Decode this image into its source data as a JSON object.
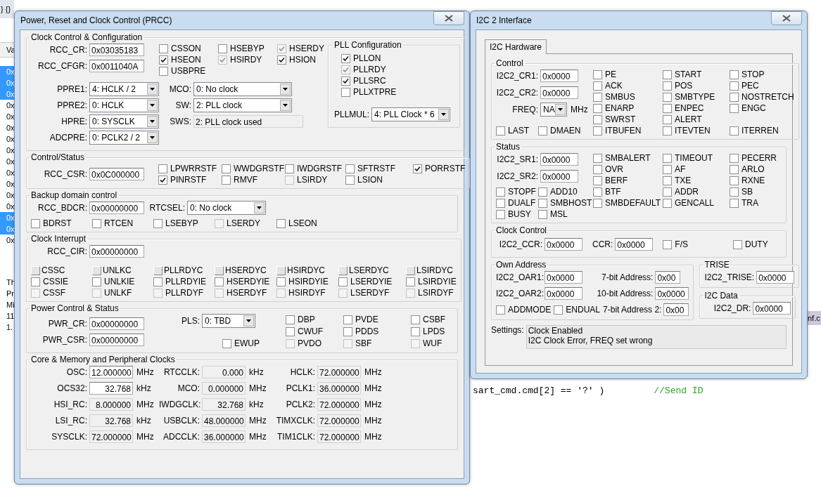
{
  "background": {
    "toolbar_text": "} {}",
    "watch_header": "Va",
    "watch_rows": [
      {
        "text": "0x",
        "selected": true
      },
      {
        "text": "0x",
        "selected": true
      },
      {
        "text": "0x",
        "selected": true
      },
      {
        "text": "0x",
        "selected": false
      },
      {
        "text": "0x",
        "selected": false
      },
      {
        "text": "0x",
        "selected": false
      },
      {
        "text": "0x",
        "selected": false
      },
      {
        "text": "0x",
        "selected": false
      },
      {
        "text": "0x",
        "selected": false
      },
      {
        "text": "0x",
        "selected": false
      },
      {
        "text": "0x",
        "selected": false
      },
      {
        "text": "0x",
        "selected": false
      },
      {
        "text": "0x",
        "selected": false
      },
      {
        "text": "0x",
        "selected": true
      },
      {
        "text": "0x",
        "selected": true
      },
      {
        "text": "0x",
        "selected": false
      }
    ],
    "notes": [
      "Th",
      "Pr",
      "Mi",
      "11",
      "1."
    ],
    "file_tab": "nf.c",
    "code": "sart_cmd.cmd[2] == '?' )",
    "comment": "//Send ID"
  },
  "prcc": {
    "title": "Power, Reset and Clock Control (PRCC)",
    "clock_config": {
      "title": "Clock Control & Configuration",
      "registers": [
        {
          "label": "RCC_CR:",
          "value": "0x03035183"
        },
        {
          "label": "RCC_CFGR:",
          "value": "0x0011040A"
        }
      ],
      "checks": [
        {
          "label": "CSSON",
          "checked": false,
          "disabled": false
        },
        {
          "label": "HSEBYP",
          "checked": false,
          "disabled": false
        },
        {
          "label": "HSERDY",
          "checked": true,
          "disabled": true
        },
        {
          "label": "HSEON",
          "checked": true,
          "disabled": false
        },
        {
          "label": "HSIRDY",
          "checked": true,
          "disabled": true
        },
        {
          "label": "HSION",
          "checked": true,
          "disabled": false
        },
        {
          "label": "USBPRE",
          "checked": false,
          "disabled": false
        }
      ],
      "selects": [
        {
          "label": "PPRE1:",
          "value": "4: HCLK / 2"
        },
        {
          "label": "PPRE2:",
          "value": "0: HCLK"
        },
        {
          "label": "HPRE:",
          "value": "0: SYSCLK"
        },
        {
          "label": "ADCPRE:",
          "value": "0: PCLK2 / 2"
        }
      ],
      "mid_selects": [
        {
          "label": "MCO:",
          "value": "0: No clock"
        },
        {
          "label": "SW:",
          "value": "2: PLL clock"
        }
      ],
      "sws": {
        "label": "SWS:",
        "value": "2: PLL clock used"
      },
      "pll": {
        "title": "PLL Configuration",
        "checks": [
          {
            "label": "PLLON",
            "checked": true,
            "disabled": false
          },
          {
            "label": "PLLRDY",
            "checked": true,
            "disabled": true
          },
          {
            "label": "PLLSRC",
            "checked": true,
            "disabled": false
          },
          {
            "label": "PLLXTPRE",
            "checked": false,
            "disabled": false
          }
        ],
        "mul": {
          "label": "PLLMUL:",
          "value": "4: PLL Clock * 6"
        }
      }
    },
    "control_status": {
      "title": "Control/Status",
      "register": {
        "label": "RCC_CSR:",
        "value": "0x0C000000"
      },
      "checks": [
        {
          "label": "LPWRRSTF",
          "checked": false,
          "disabled": false
        },
        {
          "label": "WWDGRSTF",
          "checked": false,
          "disabled": false
        },
        {
          "label": "IWDGRSTF",
          "checked": false,
          "disabled": false
        },
        {
          "label": "SFTRSTF",
          "checked": false,
          "disabled": false
        },
        {
          "label": "PORRSTF",
          "checked": true,
          "disabled": false
        },
        {
          "label": "PINRSTF",
          "checked": true,
          "disabled": false
        },
        {
          "label": "RMVF",
          "checked": false,
          "disabled": false
        },
        {
          "label": "LSIRDY",
          "checked": false,
          "disabled": true
        },
        {
          "label": "LSION",
          "checked": false,
          "disabled": false
        }
      ]
    },
    "backup": {
      "title": "Backup domain control",
      "register": {
        "label": "RCC_BDCR:",
        "value": "0x00000000"
      },
      "select": {
        "label": "RTCSEL:",
        "value": "0: No clock"
      },
      "checks": [
        {
          "label": "BDRST",
          "checked": false,
          "disabled": false
        },
        {
          "label": "RTCEN",
          "checked": false,
          "disabled": false
        },
        {
          "label": "LSEBYP",
          "checked": false,
          "disabled": false
        },
        {
          "label": "LSERDY",
          "checked": false,
          "disabled": true
        },
        {
          "label": "LSEON",
          "checked": false,
          "disabled": false
        }
      ]
    },
    "interrupt": {
      "title": "Clock Interrupt",
      "register": {
        "label": "RCC_CIR:",
        "value": "0x00000000"
      },
      "checks": [
        {
          "kind": "pulse",
          "label": "CSSC",
          "checked": false,
          "disabled": false
        },
        {
          "kind": "pulse",
          "label": "UNLKC",
          "checked": false,
          "disabled": false
        },
        {
          "kind": "pulse",
          "label": "PLLRDYC",
          "checked": false,
          "disabled": false
        },
        {
          "kind": "pulse",
          "label": "HSERDYC",
          "checked": false,
          "disabled": false
        },
        {
          "kind": "pulse",
          "label": "HSIRDYC",
          "checked": false,
          "disabled": false
        },
        {
          "kind": "pulse",
          "label": "LSERDYC",
          "checked": false,
          "disabled": false
        },
        {
          "kind": "pulse",
          "label": "LSIRDYC",
          "checked": false,
          "disabled": false
        },
        {
          "kind": "check",
          "label": "CSSIE",
          "checked": false,
          "disabled": false
        },
        {
          "kind": "check",
          "label": "UNLKIE",
          "checked": false,
          "disabled": false
        },
        {
          "kind": "check",
          "label": "PLLRDYIE",
          "checked": false,
          "disabled": false
        },
        {
          "kind": "check",
          "label": "HSERDYIE",
          "checked": false,
          "disabled": false
        },
        {
          "kind": "check",
          "label": "HSIRDYIE",
          "checked": false,
          "disabled": false
        },
        {
          "kind": "check",
          "label": "LSERDYIE",
          "checked": false,
          "disabled": false
        },
        {
          "kind": "check",
          "label": "LSIRDYIE",
          "checked": false,
          "disabled": false
        },
        {
          "kind": "check",
          "label": "CSSF",
          "checked": false,
          "disabled": true
        },
        {
          "kind": "check",
          "label": "UNLKF",
          "checked": false,
          "disabled": true
        },
        {
          "kind": "check",
          "label": "PLLRDYF",
          "checked": false,
          "disabled": true
        },
        {
          "kind": "check",
          "label": "HSERDYF",
          "checked": false,
          "disabled": true
        },
        {
          "kind": "check",
          "label": "HSIRDYF",
          "checked": false,
          "disabled": true
        },
        {
          "kind": "check",
          "label": "LSERDYF",
          "checked": false,
          "disabled": true
        },
        {
          "kind": "check",
          "label": "LSIRDYF",
          "checked": false,
          "disabled": true
        }
      ]
    },
    "power": {
      "title": "Power Control & Status",
      "registers": [
        {
          "label": "PWR_CR:",
          "value": "0x00000000"
        },
        {
          "label": "PWR_CSR:",
          "value": "0x00000000"
        }
      ],
      "select": {
        "label": "PLS:",
        "value": "0: TBD"
      },
      "checks": [
        {
          "label": "DBP",
          "checked": false,
          "disabled": false
        },
        {
          "label": "PVDE",
          "checked": false,
          "disabled": false
        },
        {
          "label": "CSBF",
          "checked": false,
          "disabled": false
        },
        {
          "label": "CWUF",
          "checked": false,
          "disabled": false
        },
        {
          "label": "PDDS",
          "checked": false,
          "disabled": false
        },
        {
          "label": "LPDS",
          "checked": false,
          "disabled": false
        },
        {
          "label": "EWUP",
          "checked": false,
          "disabled": false
        },
        {
          "label": "PVDO",
          "checked": false,
          "disabled": true
        },
        {
          "label": "SBF",
          "checked": false,
          "disabled": true
        },
        {
          "label": "WUF",
          "checked": false,
          "disabled": true
        }
      ]
    },
    "clocks": {
      "title": "Core & Memory and Peripheral Clocks",
      "columns": [
        [
          {
            "label": "OSC:",
            "value": "12.000000",
            "unit": "MHz",
            "editable": true
          },
          {
            "label": "OCS32:",
            "value": "32.768",
            "unit": "kHz",
            "editable": true
          },
          {
            "label": "HSI_RC:",
            "value": "8.000000",
            "unit": "MHz",
            "editable": false
          },
          {
            "label": "LSI_RC:",
            "value": "32.768",
            "unit": "kHz",
            "editable": false
          },
          {
            "label": "SYSCLK:",
            "value": "72.000000",
            "unit": "MHz",
            "editable": false
          }
        ],
        [
          {
            "label": "RTCCLK:",
            "value": "0.000",
            "unit": "kHz",
            "editable": false
          },
          {
            "label": "MCO:",
            "value": "0.000000",
            "unit": "MHz",
            "editable": false
          },
          {
            "label": "IWDGCLK:",
            "value": "32.768",
            "unit": "kHz",
            "editable": false
          },
          {
            "label": "USBCLK:",
            "value": "48.000000",
            "unit": "MHz",
            "editable": false
          },
          {
            "label": "ADCCLK:",
            "value": "36.000000",
            "unit": "MHz",
            "editable": false
          }
        ],
        [
          {
            "label": "HCLK:",
            "value": "72.000000",
            "unit": "MHz",
            "editable": false
          },
          {
            "label": "PCLK1:",
            "value": "36.000000",
            "unit": "MHz",
            "editable": false
          },
          {
            "label": "PCLK2:",
            "value": "72.000000",
            "unit": "MHz",
            "editable": false
          },
          {
            "label": "TIMXCLK:",
            "value": "72.000000",
            "unit": "MHz",
            "editable": false
          },
          {
            "label": "TIM1CLK:",
            "value": "72.000000",
            "unit": "MHz",
            "editable": false
          }
        ]
      ]
    }
  },
  "i2c": {
    "title": "I2C 2 Interface",
    "tabs": [
      {
        "label": "I2C Hardware",
        "selected": true
      }
    ],
    "control": {
      "title": "Control",
      "registers": [
        {
          "label": "I2C2_CR1:",
          "value": "0x0000"
        },
        {
          "label": "I2C2_CR2:",
          "value": "0x0000"
        }
      ],
      "freq": {
        "label": "FREQ:",
        "value": "NA",
        "unit": "MHz"
      },
      "checks": [
        {
          "label": "PE",
          "checked": false
        },
        {
          "label": "START",
          "checked": false
        },
        {
          "label": "STOP",
          "checked": false
        },
        {
          "label": "ACK",
          "checked": false
        },
        {
          "label": "POS",
          "checked": false
        },
        {
          "label": "PEC",
          "checked": false
        },
        {
          "label": "SMBUS",
          "checked": false
        },
        {
          "label": "SMBTYPE",
          "checked": false
        },
        {
          "label": "NOSTRETCH",
          "checked": false
        },
        {
          "label": "ENARP",
          "checked": false
        },
        {
          "label": "ENPEC",
          "checked": false
        },
        {
          "label": "ENGC",
          "checked": false
        },
        {
          "label": "SWRST",
          "checked": false
        },
        {
          "label": "ALERT",
          "checked": false
        }
      ],
      "bottom_checks": [
        {
          "label": "LAST",
          "checked": false
        },
        {
          "label": "DMAEN",
          "checked": false
        },
        {
          "label": "ITBUFEN",
          "checked": false
        },
        {
          "label": "ITEVTEN",
          "checked": false
        },
        {
          "label": "ITERREN",
          "checked": false
        }
      ]
    },
    "status": {
      "title": "Status",
      "registers": [
        {
          "label": "I2C2_SR1:",
          "value": "0x0000"
        },
        {
          "label": "I2C2_SR2:",
          "value": "0x0000"
        }
      ],
      "checks": [
        {
          "label": "SMBALERT",
          "checked": false
        },
        {
          "label": "TIMEOUT",
          "checked": false
        },
        {
          "label": "PECERR",
          "checked": false
        },
        {
          "label": "OVR",
          "checked": false
        },
        {
          "label": "AF",
          "checked": false
        },
        {
          "label": "ARLO",
          "checked": false
        },
        {
          "label": "BERF",
          "checked": false
        },
        {
          "label": "TXE",
          "checked": false
        },
        {
          "label": "RXNE",
          "checked": false
        }
      ],
      "bottom_checks": [
        {
          "label": "STOPF",
          "checked": false
        },
        {
          "label": "ADD10",
          "checked": false
        },
        {
          "label": "BTF",
          "checked": false
        },
        {
          "label": "ADDR",
          "checked": false
        },
        {
          "label": "SB",
          "checked": false
        },
        {
          "label": "DUALF",
          "checked": false
        },
        {
          "label": "SMBHOST",
          "checked": false
        },
        {
          "label": "SMBDEFAULT",
          "checked": false
        },
        {
          "label": "GENCALL",
          "checked": false
        },
        {
          "label": "TRA",
          "checked": false
        },
        {
          "label": "BUSY",
          "checked": false
        },
        {
          "label": "MSL",
          "checked": false
        }
      ]
    },
    "clock_control": {
      "title": "Clock Control",
      "fields": [
        {
          "label": "I2C2_CCR:",
          "value": "0x0000"
        },
        {
          "label": "CCR:",
          "value": "0x0000"
        }
      ],
      "checks": [
        {
          "label": "F/S",
          "checked": false
        },
        {
          "label": "DUTY",
          "checked": false
        }
      ]
    },
    "own_address": {
      "title": "Own Address",
      "registers": [
        {
          "label": "I2C2_OAR1:",
          "value": "0x0000"
        },
        {
          "label": "I2C2_OAR2:",
          "value": "0x0000"
        }
      ],
      "addresses": [
        {
          "label": "7-bit Address:",
          "value": "0x00"
        },
        {
          "label": "10-bit Address:",
          "value": "0x0000"
        }
      ],
      "checks": [
        {
          "label": "ADDMODE",
          "checked": false
        },
        {
          "label": "ENDUAL",
          "checked": false
        }
      ],
      "address2": {
        "label": "7-bit Address 2:",
        "value": "0x00"
      }
    },
    "trise": {
      "title": "TRISE",
      "register": {
        "label": "I2C2_TRISE:",
        "value": "0x0000"
      }
    },
    "data": {
      "title": "I2C Data",
      "register": {
        "label": "I2C2_DR:",
        "value": "0x0000"
      }
    },
    "settings": {
      "label": "Settings:",
      "lines": [
        "Clock Enabled",
        "I2C Clock Error, FREQ set wrong"
      ]
    }
  }
}
